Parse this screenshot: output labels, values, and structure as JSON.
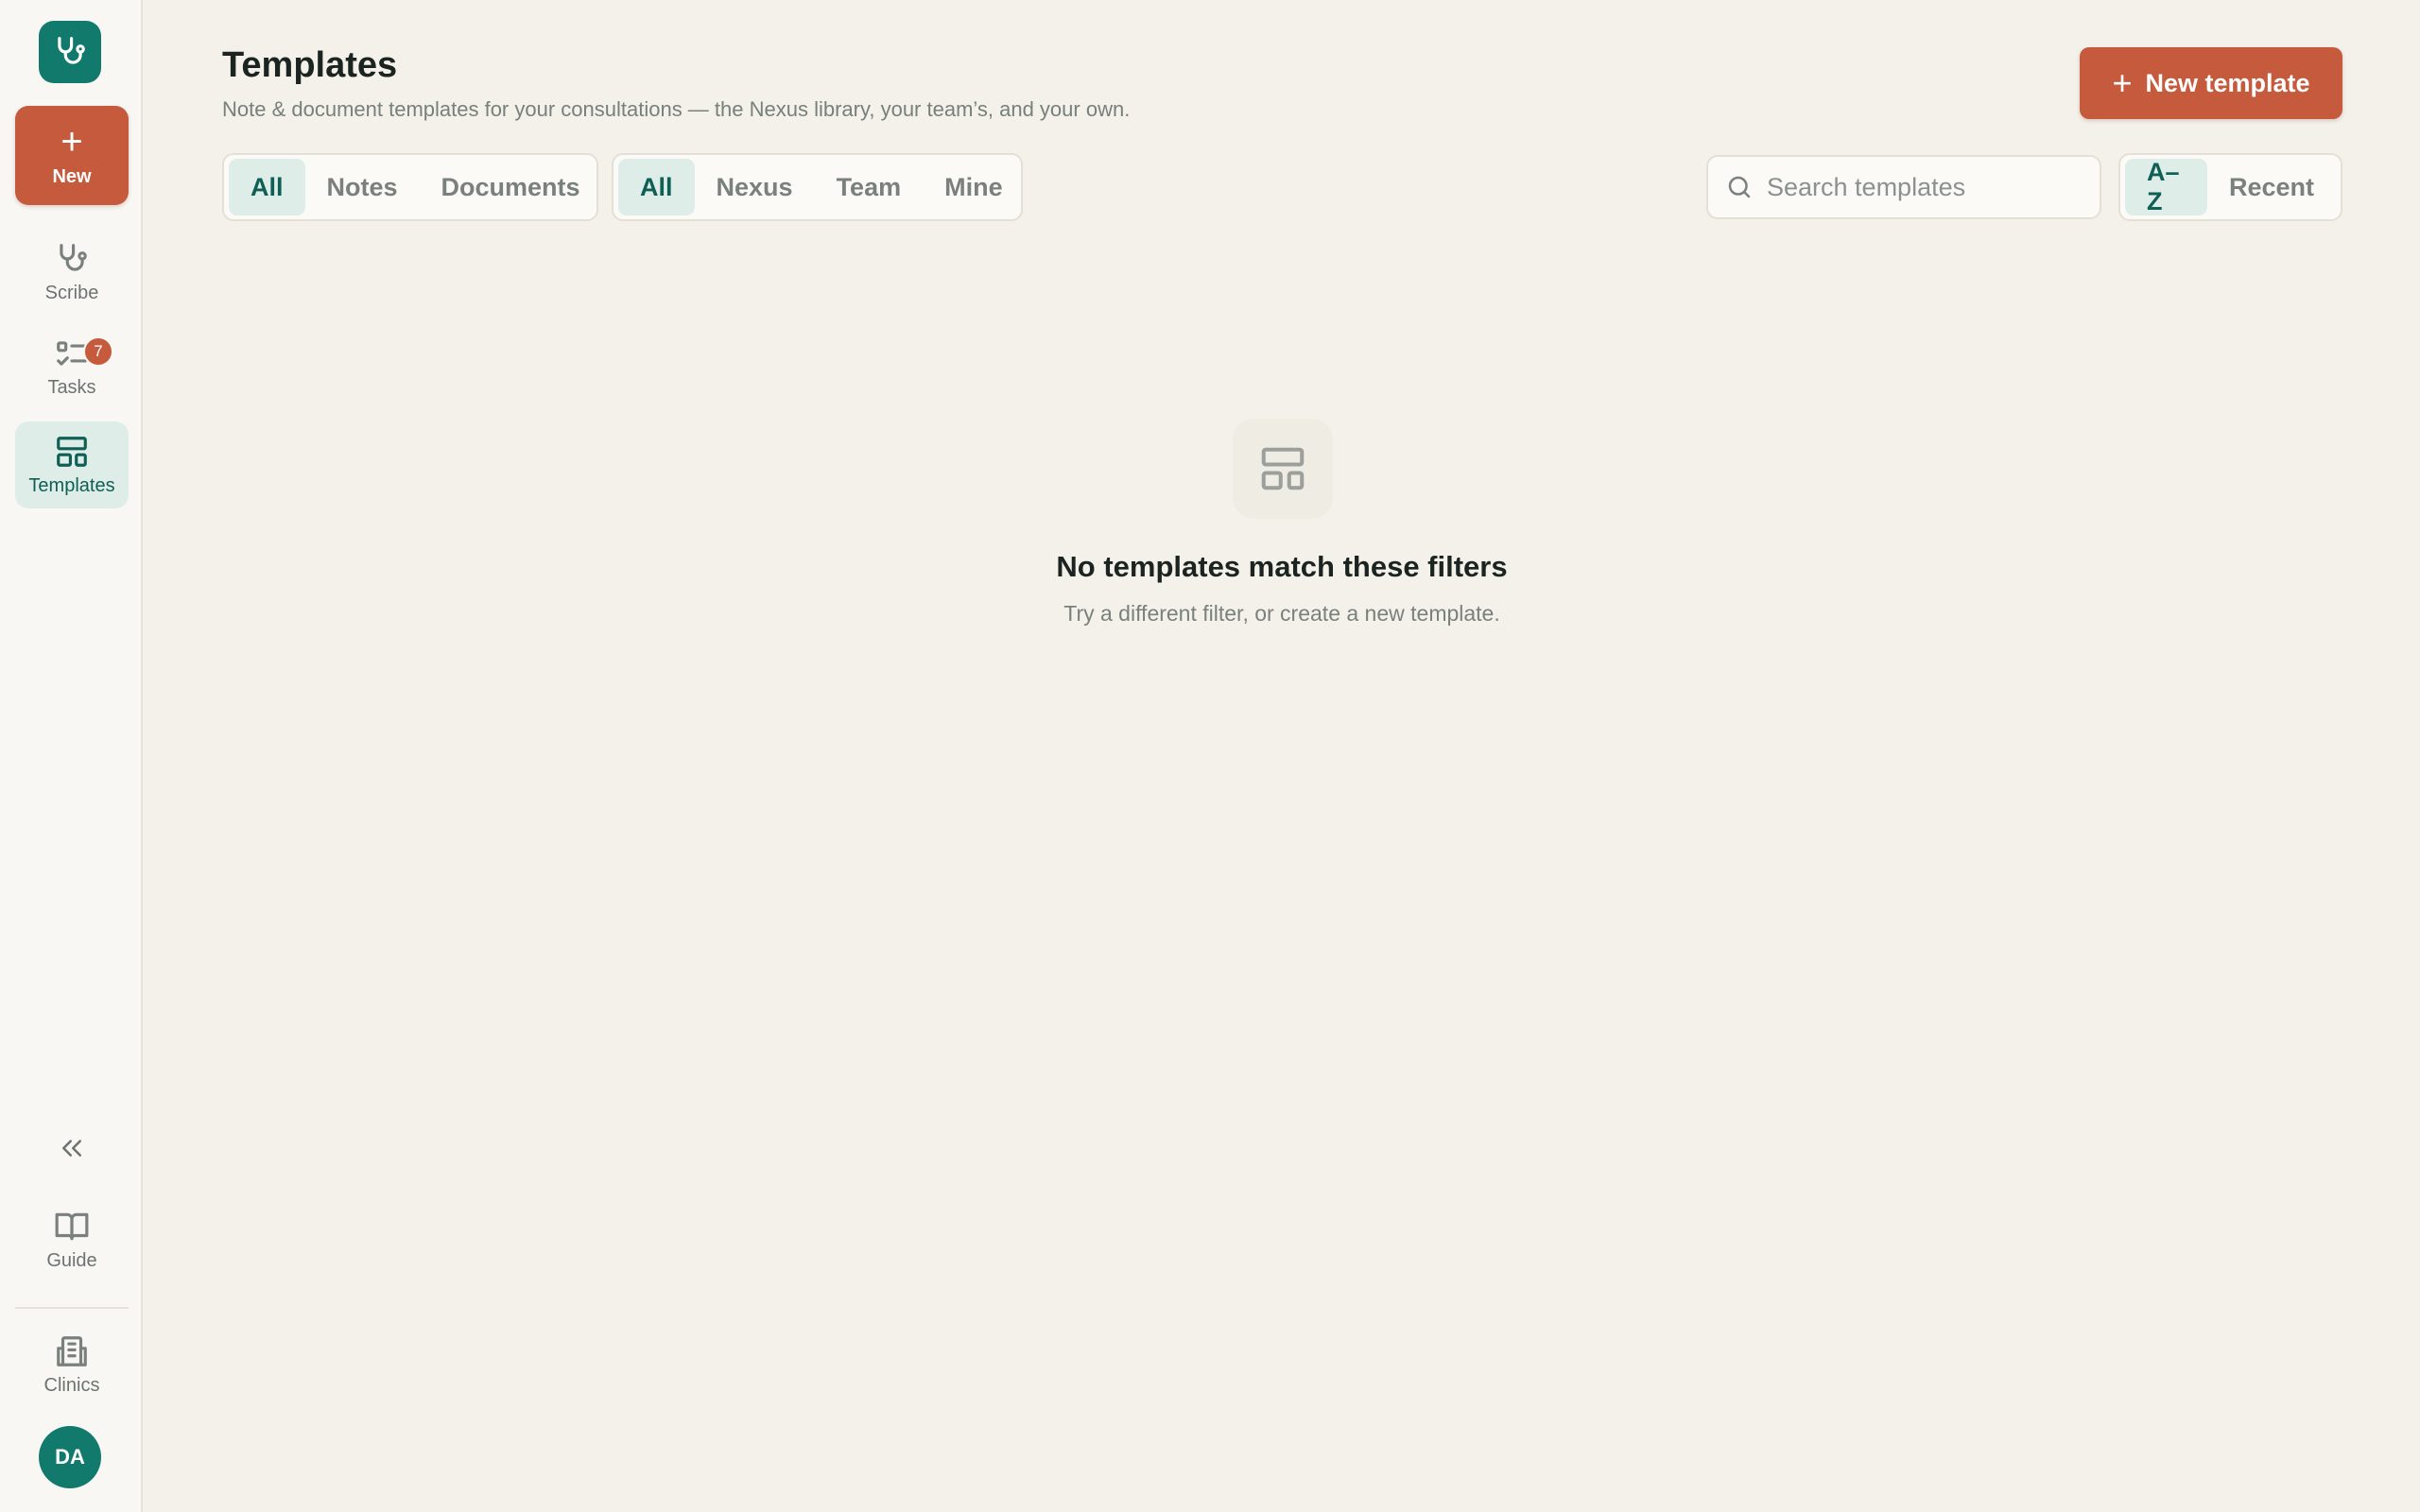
{
  "sidebar": {
    "new_label": "New",
    "nav": [
      {
        "label": "Scribe",
        "icon": "stethoscope-icon"
      },
      {
        "label": "Tasks",
        "icon": "tasks-icon",
        "badge": "7"
      },
      {
        "label": "Templates",
        "icon": "templates-icon",
        "active": true
      }
    ],
    "guide_label": "Guide",
    "clinics_label": "Clinics",
    "avatar_initials": "DA"
  },
  "header": {
    "title": "Templates",
    "subtitle": "Note & document templates for your consultations — the Nexus library, your team’s, and your own.",
    "new_template_label": "New template"
  },
  "filters": {
    "type": {
      "options": [
        "All",
        "Notes",
        "Documents"
      ],
      "selected": "All"
    },
    "source": {
      "options": [
        "All",
        "Nexus",
        "Team",
        "Mine"
      ],
      "selected": "All"
    },
    "search_placeholder": "Search templates",
    "sort": {
      "options": [
        "A–Z",
        "Recent"
      ],
      "selected": "A–Z"
    }
  },
  "empty_state": {
    "title": "No templates match these filters",
    "subtitle": "Try a different filter, or create a new template."
  },
  "colors": {
    "brand": "#127a6c",
    "accent": "#c55a3c",
    "background": "#f4f1ea",
    "active_tab": "#dfede9"
  }
}
